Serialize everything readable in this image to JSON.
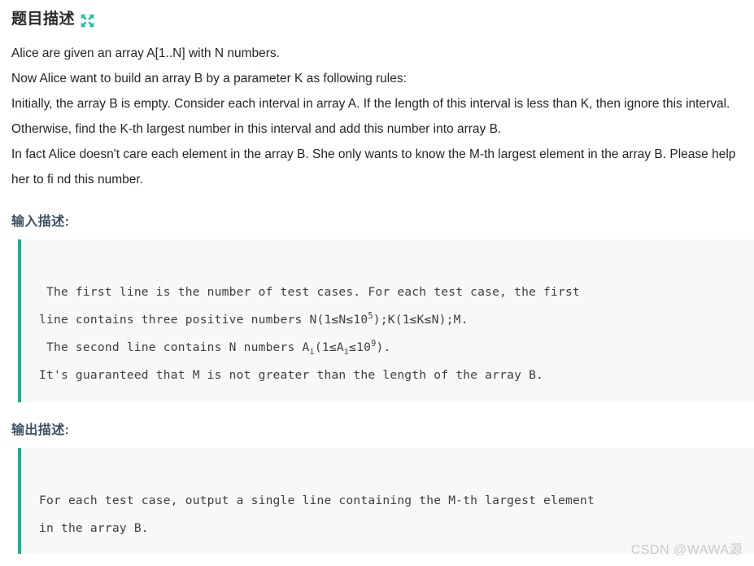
{
  "header": {
    "title": "题目描述",
    "expand_icon": "expand-arrows-icon",
    "icon_color": "#1fc0a0"
  },
  "description": {
    "paragraphs": [
      "Alice are given an array A[1..N] with N numbers.",
      "Now Alice want to build an array B by a parameter K as following rules:",
      "Initially, the array B is empty. Consider each interval in array A. If the length of this interval is less than K, then ignore this interval. Otherwise, find the K-th largest number in this interval and add this number into array B.",
      "In fact Alice doesn't care each element in the array B. She only wants to know the M-th largest element in the array B. Please help her to fi nd this number."
    ]
  },
  "input_section": {
    "heading": "输入描述:",
    "code_lines": [
      " The first line is the number of test cases. For each test case, the first",
      "line contains three positive numbers N(1≤N≤10",
      " The second line contains N numbers A",
      "It's guaranteed that M is not greater than the length of the array B."
    ],
    "line1": " The first line is the number of test cases. For each test case, the first",
    "line2_a": "line contains three positive numbers N(1≤N≤10",
    "line2_sup": "5",
    "line2_b": ");K(1≤K≤N);M.",
    "line3_a": " The second line contains N numbers A",
    "line3_sub1": "i",
    "line3_b": "(1≤A",
    "line3_sub2": "i",
    "line3_c": "≤10",
    "line3_sup": "9",
    "line3_d": ").",
    "line4": "It's guaranteed that M is not greater than the length of the array B."
  },
  "output_section": {
    "heading": "输出描述:",
    "line1": "For each test case, output a single line containing the M-th largest element",
    "line2": "in the array B."
  },
  "watermark": {
    "text": "CSDN @WAWA源"
  },
  "colors": {
    "accent_teal": "#16b193",
    "heading_slate": "#3f5266",
    "code_bg": "#f8f8f8",
    "body_text": "#232629",
    "watermark": "#c9c9c9"
  }
}
